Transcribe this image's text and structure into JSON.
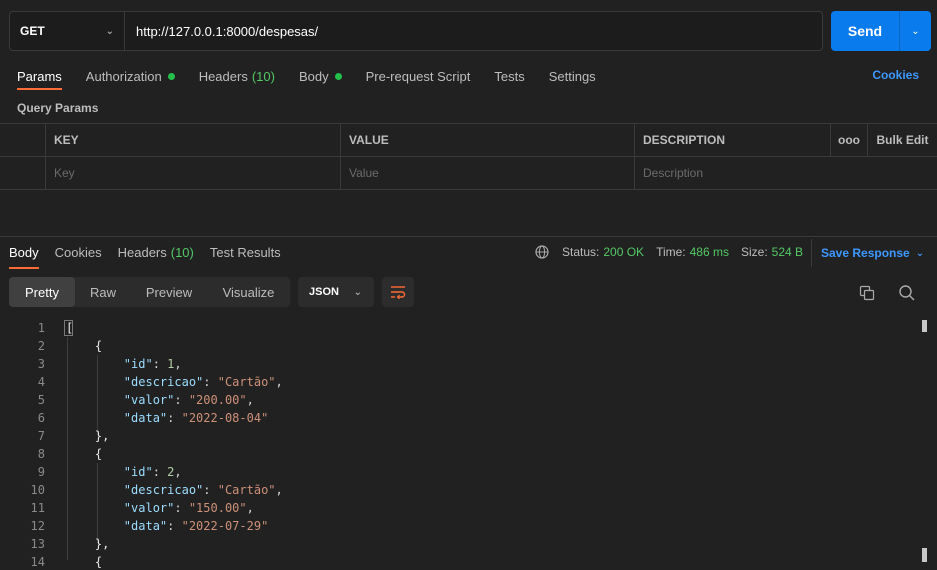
{
  "request": {
    "method": "GET",
    "url": "http://127.0.0.1:8000/despesas/",
    "send_label": "Send"
  },
  "req_tabs": {
    "params": "Params",
    "authorization": "Authorization",
    "headers": "Headers",
    "headers_count": "(10)",
    "body": "Body",
    "prerequest": "Pre-request Script",
    "tests": "Tests",
    "settings": "Settings",
    "cookies": "Cookies"
  },
  "query_params": {
    "title": "Query Params",
    "headers": {
      "key": "KEY",
      "value": "VALUE",
      "description": "DESCRIPTION",
      "more": "ooo",
      "bulk_edit": "Bulk Edit"
    },
    "placeholders": {
      "key": "Key",
      "value": "Value",
      "description": "Description"
    }
  },
  "response": {
    "tabs": {
      "body": "Body",
      "cookies": "Cookies",
      "headers": "Headers",
      "headers_count": "(10)",
      "test_results": "Test Results"
    },
    "status_label": "Status:",
    "status_value": "200 OK",
    "time_label": "Time:",
    "time_value": "486 ms",
    "size_label": "Size:",
    "size_value": "524 B",
    "save_response": "Save Response",
    "views": {
      "pretty": "Pretty",
      "raw": "Raw",
      "preview": "Preview",
      "visualize": "Visualize"
    },
    "format": "JSON"
  },
  "colors": {
    "accent": "#ff6c37",
    "send": "#097bed",
    "link": "#3d98ff",
    "success": "#54c866"
  },
  "code_lines": [
    "[",
    "    {",
    "        \"id\": 1,",
    "        \"descricao\": \"Cartão\",",
    "        \"valor\": \"200.00\",",
    "        \"data\": \"2022-08-04\"",
    "    },",
    "    {",
    "        \"id\": 2,",
    "        \"descricao\": \"Cartão\",",
    "        \"valor\": \"150.00\",",
    "        \"data\": \"2022-07-29\"",
    "    },",
    "    {"
  ],
  "line_numbers": [
    "1",
    "2",
    "3",
    "4",
    "5",
    "6",
    "7",
    "8",
    "9",
    "10",
    "11",
    "12",
    "13",
    "14"
  ]
}
